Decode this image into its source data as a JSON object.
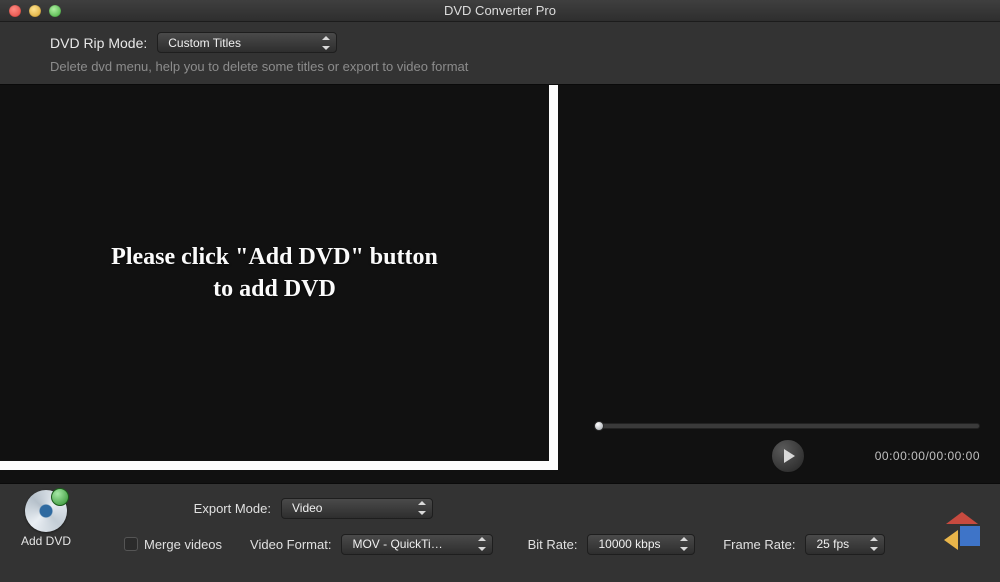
{
  "window": {
    "title": "DVD Converter Pro"
  },
  "header": {
    "rip_mode_label": "DVD Rip Mode:",
    "rip_mode_value": "Custom Titles",
    "hint": "Delete dvd menu, help you to delete some titles or export to video format"
  },
  "main": {
    "placeholder_line1": "Please click \"Add DVD\" button",
    "placeholder_line2": "to add DVD"
  },
  "preview": {
    "timecode": "00:00:00/00:00:00"
  },
  "footer": {
    "add_dvd_label": "Add DVD",
    "export_mode_label": "Export Mode:",
    "export_mode_value": "Video",
    "merge_videos_label": "Merge videos",
    "merge_videos_checked": false,
    "video_format_label": "Video Format:",
    "video_format_value": "MOV - QuickTi…",
    "bit_rate_label": "Bit Rate:",
    "bit_rate_value": "10000 kbps",
    "frame_rate_label": "Frame Rate:",
    "frame_rate_value": "25 fps"
  }
}
